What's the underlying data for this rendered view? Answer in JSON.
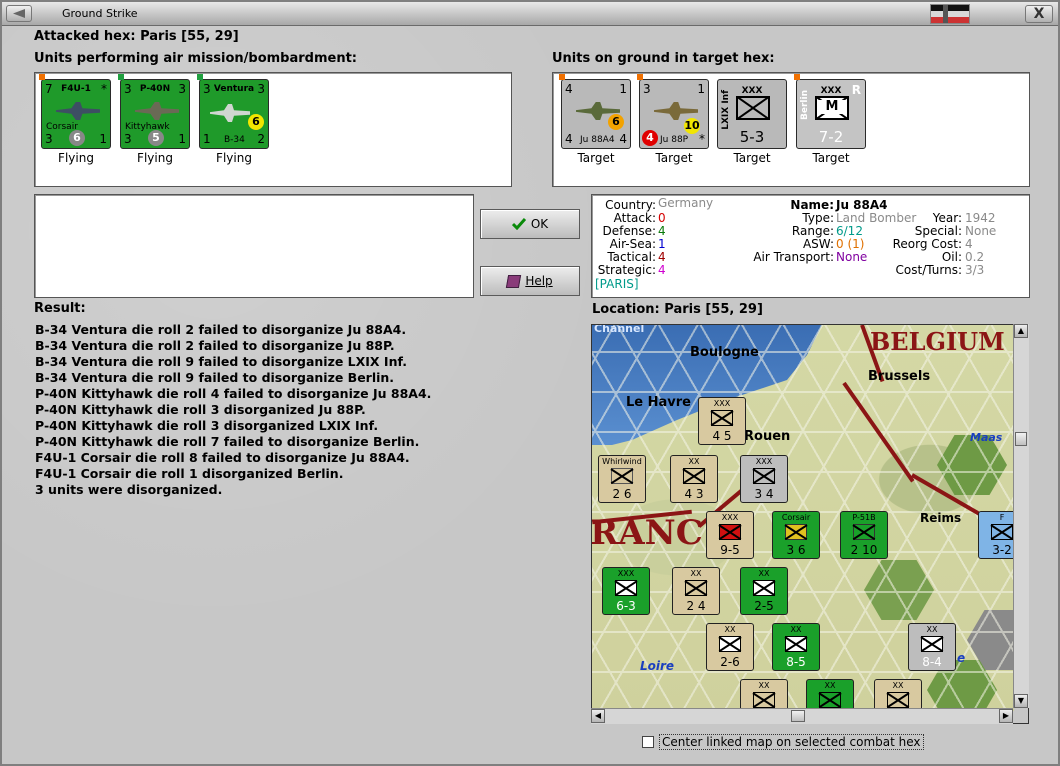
{
  "window": {
    "title": "Ground Strike",
    "close_label": "X"
  },
  "attacked_hex": "Attacked hex: Paris [55, 29]",
  "air_units_label": "Units performing air mission/bombardment:",
  "ground_units_label": "Units on ground in target hex:",
  "air_units": [
    {
      "top_left": "7",
      "name": "F4U-1",
      "top_right": "*",
      "sub": "Corsair",
      "bottom_left": "3",
      "badge": "6",
      "bottom_right": "1",
      "status": "Flying",
      "badge_color": "#888888"
    },
    {
      "top_left": "3",
      "name": "P-40N",
      "top_right": "3",
      "sub": "Kittyhawk",
      "bottom_left": "3",
      "badge": "5",
      "bottom_right": "1",
      "status": "Flying",
      "badge_color": "#888888"
    },
    {
      "top_left": "3",
      "name": "Ventura",
      "top_right": "3",
      "sub": "B-34",
      "bottom_left": "1",
      "badge": "6",
      "bottom_right": "2",
      "status": "Flying",
      "badge_color": "#f2e600"
    }
  ],
  "ground_units": [
    {
      "type": "air",
      "top_left": "4",
      "top_right": "1",
      "sub": "Ju 88A4",
      "bottom_left": "4",
      "bottom_right": "4",
      "badge": "6",
      "badge_color": "#f2a200",
      "status": "Target"
    },
    {
      "type": "air",
      "top_left": "3",
      "top_right": "1",
      "sub": "Ju 88P",
      "bottom_left": "4",
      "bottom_right": "*",
      "badge": "10",
      "badge_color": "#f2e600",
      "status": "Target"
    },
    {
      "type": "land",
      "corps": "XXX",
      "side": "LXIX Inf",
      "value": "5-3",
      "status": "Target"
    },
    {
      "type": "land",
      "corps": "XXX",
      "side": "Berlin",
      "value": "7-2",
      "marker": "R",
      "letter": "M",
      "status": "Target"
    }
  ],
  "buttons": {
    "ok": "OK",
    "help": "Help"
  },
  "info": {
    "country_k": "Country:",
    "country_v": "Germany",
    "attack_k": "Attack:",
    "attack_v": "0",
    "defense_k": "Defense:",
    "defense_v": "4",
    "airsea_k": "Air-Sea:",
    "airsea_v": "1",
    "tactical_k": "Tactical:",
    "tactical_v": "4",
    "strategic_k": "Strategic:",
    "strategic_v": "4",
    "location_tag": "[PARIS]",
    "name_k": "Name:",
    "name_v": "Ju 88A4",
    "type_k": "Type:",
    "type_v": "Land Bomber",
    "range_k": "Range:",
    "range_v": "6/12",
    "asw_k": "ASW:",
    "asw_v": "0 (1)",
    "airtransport_k": "Air Transport:",
    "airtransport_v": "None",
    "year_k": "Year:",
    "year_v": "1942",
    "special_k": "Special:",
    "special_v": "None",
    "reorg_k": "Reorg Cost:",
    "reorg_v": "4",
    "oil_k": "Oil:",
    "oil_v": "0.2",
    "costturns_k": "Cost/Turns:",
    "costturns_v": "3/3"
  },
  "result_label": "Result:",
  "results": [
    "B-34 Ventura die roll 2 failed to disorganize Ju 88A4.",
    "B-34 Ventura die roll 2 failed to disorganize Ju 88P.",
    "B-34 Ventura die roll 9 failed to disorganize LXIX Inf.",
    "B-34 Ventura die roll 9 failed to disorganize Berlin.",
    "P-40N Kittyhawk die roll 4 failed to disorganize Ju 88A4.",
    "P-40N Kittyhawk die roll 3 disorganized Ju 88P.",
    "P-40N Kittyhawk die roll 3 disorganized LXIX Inf.",
    "P-40N Kittyhawk die roll 7 failed to disorganize Berlin.",
    "F4U-1 Corsair die roll 8 failed to disorganize Ju 88A4.",
    "F4U-1 Corsair die roll 1 disorganized Berlin.",
    "3 units were disorganized."
  ],
  "location_label": "Location: Paris [55, 29]",
  "map": {
    "places": {
      "channel": "Channel",
      "belgium": "BELGIUM",
      "boulogne": "Boulogne",
      "brussels": "Brussels",
      "lehavre": "Le Havre",
      "rouen": "Rouen",
      "maas": "Maas",
      "reims": "Reims",
      "france": "RANC",
      "loire": "Loire",
      "e": "e"
    },
    "counters": [
      {
        "label": "4 5",
        "top": "XXX",
        "color": "tan"
      },
      {
        "label": "2 6",
        "top": "Whirlwind",
        "color": "tan"
      },
      {
        "label": "4 3",
        "top": "XX",
        "color": "tan"
      },
      {
        "label": "3 4",
        "top": "XXX",
        "color": "mgrey"
      },
      {
        "label": "9-5",
        "top": "XXX",
        "color": "tan"
      },
      {
        "label": "3 6",
        "top": "Corsair",
        "color": "mgreen"
      },
      {
        "label": "2 10",
        "top": "P-51B",
        "color": "mgreen"
      },
      {
        "label": "3-2",
        "top": "F",
        "color": "mblue"
      },
      {
        "label": "6-3",
        "top": "XXX",
        "color": "mgreen"
      },
      {
        "label": "2 4",
        "top": "XX",
        "color": "tan"
      },
      {
        "label": "2-5",
        "top": "XX",
        "color": "mgreen"
      },
      {
        "label": "2-6",
        "top": "XX",
        "color": "tan"
      },
      {
        "label": "8-5",
        "top": "XX",
        "color": "mgreen"
      },
      {
        "label": "8-4",
        "top": "XX",
        "color": "mgrey"
      },
      {
        "label": "",
        "top": "XX",
        "color": "tan"
      },
      {
        "label": "",
        "top": "XX",
        "color": "mgreen"
      },
      {
        "label": "",
        "top": "XX",
        "color": "tan"
      }
    ]
  },
  "checkbox_label": "Center linked map on selected combat hex"
}
